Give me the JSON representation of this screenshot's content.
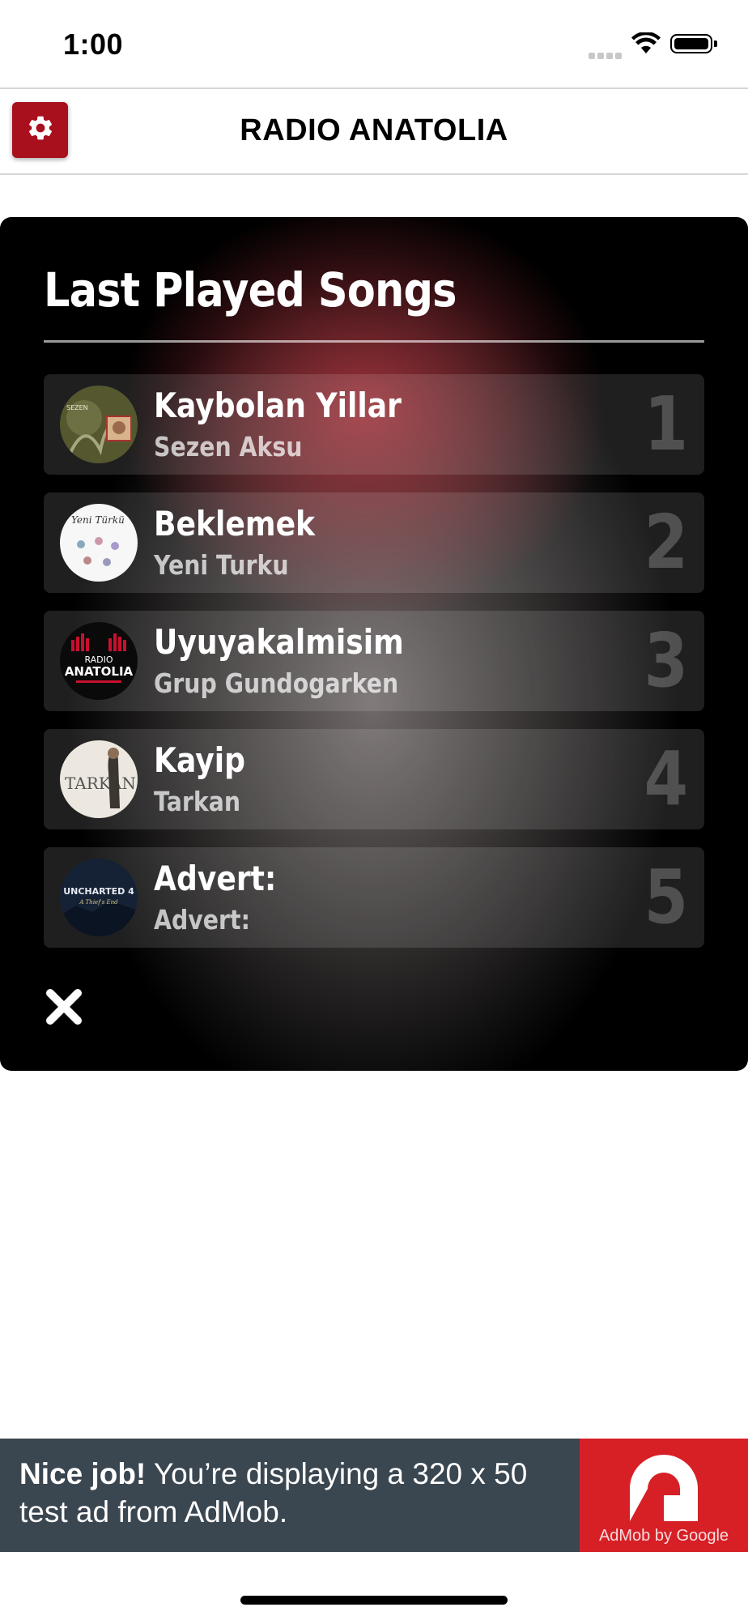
{
  "status_bar": {
    "time": "1:00"
  },
  "header": {
    "title": "RADIO ANATOLIA",
    "settings_icon": "gear-icon"
  },
  "panel": {
    "title": "Last Played Songs",
    "songs": [
      {
        "title": "Kaybolan Yillar",
        "artist": "Sezen Aksu",
        "rank": "1"
      },
      {
        "title": "Beklemek",
        "artist": "Yeni Turku",
        "rank": "2"
      },
      {
        "title": "Uyuyakalmisim",
        "artist": "Grup Gundogarken",
        "rank": "3"
      },
      {
        "title": "Kayip",
        "artist": "Tarkan",
        "rank": "4"
      },
      {
        "title": "Advert:",
        "artist": "Advert:",
        "rank": "5"
      }
    ],
    "album_art": [
      {
        "text": "SEZEN"
      },
      {
        "text": "Yeni Türkü"
      },
      {
        "text_line1": "RADIO",
        "text_line2": "ANATOLIA"
      },
      {
        "text": "TARKAN"
      },
      {
        "text_line1": "UNCHARTED 4",
        "text_line2": "A Thief's End"
      }
    ],
    "close_icon": "close-icon"
  },
  "ad": {
    "bold": "Nice job!",
    "text": " You’re displaying a 320 x 50 test ad from AdMob.",
    "brand": "AdMob by Google"
  },
  "colors": {
    "accent": "#a8101e",
    "ad_bg": "#3a4650",
    "ad_logo": "#d71f26"
  }
}
